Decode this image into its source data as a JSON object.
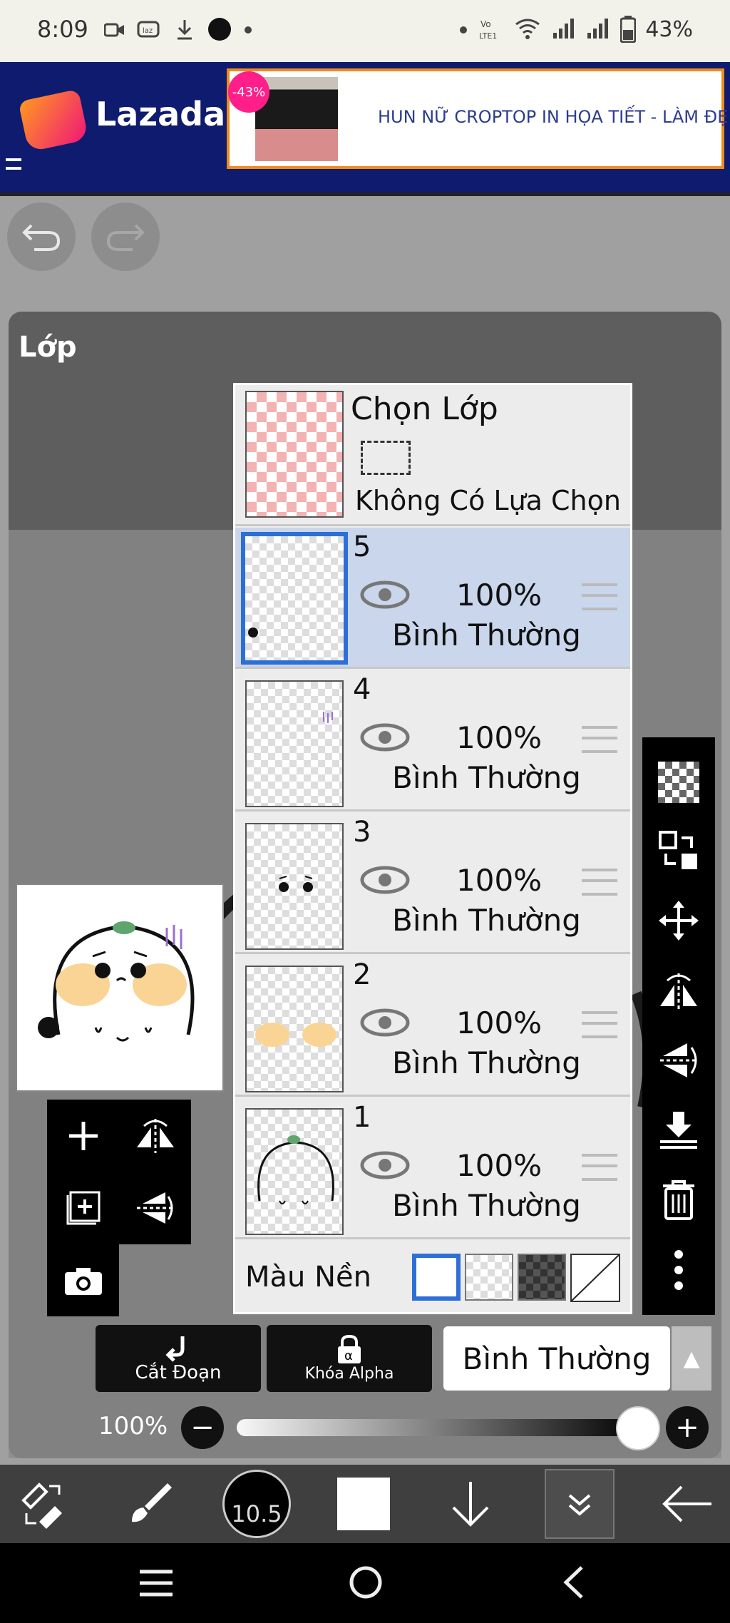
{
  "status_bar": {
    "time": "8:09",
    "battery": "43%",
    "icons": [
      "video-icon",
      "laz-icon",
      "download-icon",
      "dot-icon",
      "dot-icon",
      "volte-icon",
      "wifi-icon",
      "signal-icon",
      "signal-icon",
      "battery-icon"
    ]
  },
  "ad": {
    "brand": "Lazada",
    "discount": "-43%",
    "title": "HUN NỮ CROPTOP IN HỌA TIẾT - LÀM ĐẸ"
  },
  "top_buttons": {
    "undo_icon": "undo-icon",
    "redo_icon": "redo-icon"
  },
  "layer_panel": {
    "title": "Lớp",
    "selection_layer": {
      "title": "Chọn Lớp",
      "subtitle": "Không Có Lựa Chọn"
    },
    "layers": [
      {
        "number": "5",
        "opacity": "100%",
        "blend": "Bình Thường",
        "selected": true
      },
      {
        "number": "4",
        "opacity": "100%",
        "blend": "Bình Thường",
        "selected": false
      },
      {
        "number": "3",
        "opacity": "100%",
        "blend": "Bình Thường",
        "selected": false
      },
      {
        "number": "2",
        "opacity": "100%",
        "blend": "Bình Thường",
        "selected": false
      },
      {
        "number": "1",
        "opacity": "100%",
        "blend": "Bình Thường",
        "selected": false
      }
    ],
    "background_label": "Màu Nền",
    "clip_label": "Cắt Đoạn",
    "alpha_lock_label": "Khóa Alpha",
    "blend_mode": "Bình Thường",
    "opacity_label": "100%",
    "opacity_value": 1.0
  },
  "right_tools": [
    "transparent-icon",
    "swap-layer-icon",
    "move-icon",
    "flip-horizontal-icon",
    "flip-vertical-icon",
    "merge-down-icon",
    "trash-icon",
    "more-icon"
  ],
  "left_tools": [
    "add-layer-icon",
    "flip-h-icon",
    "add-folder-icon",
    "flip-v-icon",
    "camera-icon"
  ],
  "toolbar": {
    "brush_size": "10.5",
    "accent": "#2d6fd6",
    "icons": [
      "swap-tool-icon",
      "brush-icon",
      "brush-size-icon",
      "color-swatch-icon",
      "down-arrow-icon",
      "layers-down-icon",
      "back-arrow-icon"
    ]
  },
  "nav": {
    "icons": [
      "recents-icon",
      "home-icon",
      "back-icon"
    ]
  }
}
